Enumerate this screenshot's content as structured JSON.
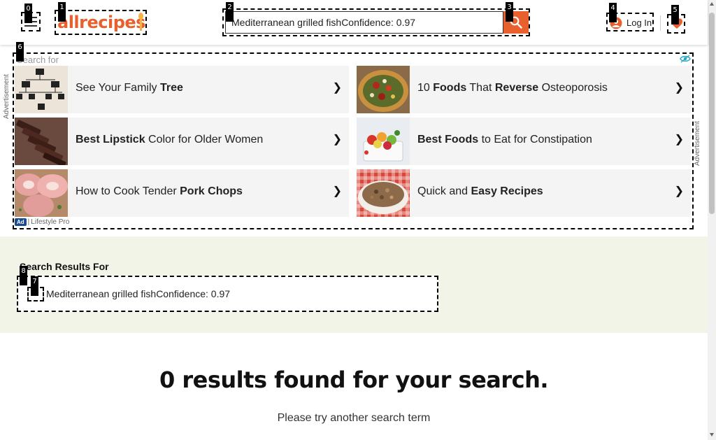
{
  "header": {
    "logo_text": "allrecipes",
    "search_value": "Mediterranean grilled fishConfidence: 0.97",
    "login_label": "Log In"
  },
  "ad": {
    "search_for_label": "Search for",
    "advertisement_label": "Advertisement",
    "badge": "Ad",
    "provider": "Lifestyle Pro",
    "items": [
      {
        "pre": "See Your Family ",
        "bold": "Tree",
        "post": ""
      },
      {
        "pre": "10 ",
        "bold": "Foods",
        "post": " That ",
        "bold2": "Reverse",
        "post2": " Osteoporosis"
      },
      {
        "pre": "",
        "bold": "Best Lipstick",
        "post": " Color for Older Women"
      },
      {
        "pre": "",
        "bold": "Best Foods",
        "post": " to Eat for Constipation"
      },
      {
        "pre": "How to Cook Tender ",
        "bold": "Pork Chops",
        "post": ""
      },
      {
        "pre": "Quick and ",
        "bold": "Easy Recipes",
        "post": ""
      }
    ],
    "chevron": "❯"
  },
  "results": {
    "heading": "Search Results For",
    "query": "Mediterranean grilled fishConfidence: 0.97",
    "no_results": "0 results found for your search.",
    "try_another": "Please try another search term"
  },
  "tags": [
    "0",
    "1",
    "2",
    "3",
    "4",
    "5",
    "6",
    "7",
    "8"
  ],
  "colors": {
    "brand": "#e8602d",
    "results_band": "#f3f4e8"
  },
  "icons": {
    "menu": "hamburger-menu-icon",
    "search": "search-icon",
    "login": "user-icon",
    "favorites": "heart-icon",
    "ad_choices": "eye-icon"
  }
}
